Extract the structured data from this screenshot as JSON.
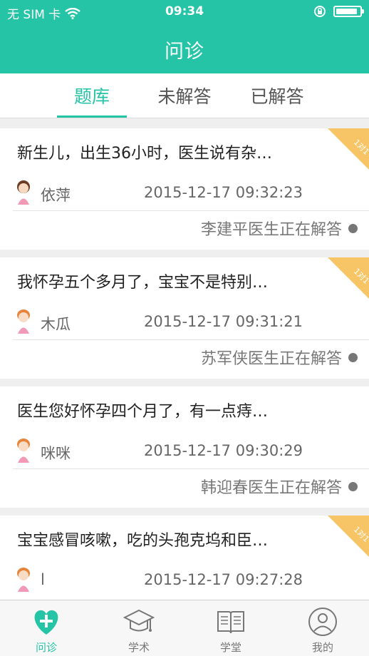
{
  "status_bar": {
    "carrier": "无 SIM 卡",
    "time": "09:34",
    "battery_level": 0.9
  },
  "nav": {
    "title": "问诊"
  },
  "tabs": [
    {
      "label": "题库",
      "active": true
    },
    {
      "label": "未解答",
      "active": false
    },
    {
      "label": "已解答",
      "active": false
    }
  ],
  "questions": [
    {
      "title": "新生儿，出生36小时，医生说有杂…",
      "user": "依萍",
      "time": "2015-12-17 09:32:23",
      "status": "李建平医生正在解答",
      "ribbon": "1对1"
    },
    {
      "title": "我怀孕五个多月了，宝宝不是特别…",
      "user": "木瓜",
      "time": "2015-12-17 09:31:21",
      "status": "苏军侠医生正在解答",
      "ribbon": "1对1"
    },
    {
      "title": "医生您好怀孕四个月了，有一点痔…",
      "user": "咪咪",
      "time": "2015-12-17 09:30:29",
      "status": "韩迎春医生正在解答",
      "ribbon": ""
    },
    {
      "title": "宝宝感冒咳嗽，吃的头孢克坞和臣…",
      "user": "l",
      "time": "2015-12-17 09:27:28",
      "status": "",
      "ribbon": "1对1"
    }
  ],
  "bottom_nav": [
    {
      "label": "问诊",
      "icon": "heart-plus-icon",
      "active": true
    },
    {
      "label": "学术",
      "icon": "graduation-cap-icon",
      "active": false
    },
    {
      "label": "学堂",
      "icon": "open-book-icon",
      "active": false
    },
    {
      "label": "我的",
      "icon": "user-profile-icon",
      "active": false
    }
  ],
  "colors": {
    "accent": "#25c4a6",
    "ribbon": "#f7c566",
    "background": "#efefef"
  }
}
